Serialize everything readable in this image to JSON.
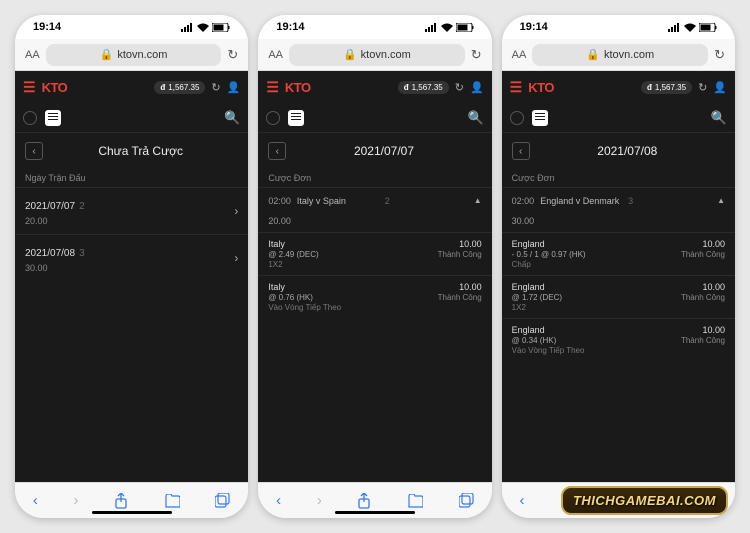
{
  "status": {
    "time": "19:14"
  },
  "url": {
    "aa": "AA",
    "domain": "ktovn.com"
  },
  "header": {
    "logo": "KTO",
    "currency": "đ",
    "balance": "1,567.35"
  },
  "watermark": "THICHGAMEBAI.COM",
  "screens": [
    {
      "title": "Chưa Trả Cược",
      "section": "Ngày Trận Đấu",
      "dates": [
        {
          "date": "2021/07/07",
          "count": "2",
          "amount": "20.00"
        },
        {
          "date": "2021/07/08",
          "count": "3",
          "amount": "30.00"
        }
      ]
    },
    {
      "title": "2021/07/07",
      "section": "Cược Đơn",
      "match": {
        "time": "02:00",
        "name": "Italy v Spain",
        "count": "2",
        "amount": "20.00"
      },
      "bets": [
        {
          "team": "Italy",
          "odds": "@ 2.49 (DEC)",
          "type": "1X2",
          "stake": "10.00",
          "status": "Thành Công"
        },
        {
          "team": "Italy",
          "odds": "@ 0.76 (HK)",
          "type": "Vào Vòng Tiếp Theo",
          "stake": "10.00",
          "status": "Thành Công"
        }
      ]
    },
    {
      "title": "2021/07/08",
      "section": "Cược Đơn",
      "match": {
        "time": "02:00",
        "name": "England v Denmark",
        "count": "3",
        "amount": "30.00"
      },
      "bets": [
        {
          "team": "England",
          "odds": "- 0.5 / 1 @ 0.97 (HK)",
          "type": "Chấp",
          "stake": "10.00",
          "status": "Thành Công"
        },
        {
          "team": "England",
          "odds": "@ 1.72 (DEC)",
          "type": "1X2",
          "stake": "10.00",
          "status": "Thành Công"
        },
        {
          "team": "England",
          "odds": "@ 0.34 (HK)",
          "type": "Vào Vòng Tiếp Theo",
          "stake": "10.00",
          "status": "Thành Công"
        }
      ]
    }
  ]
}
